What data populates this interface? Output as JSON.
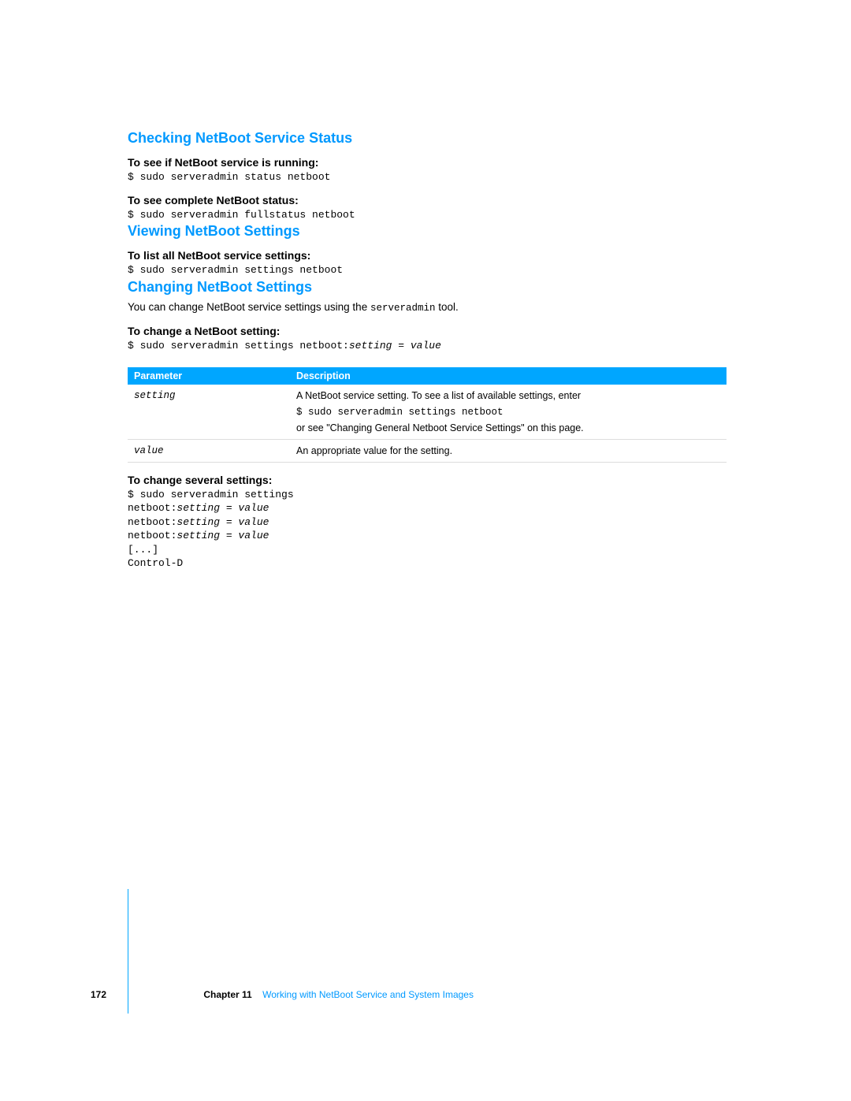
{
  "sections": {
    "s1": {
      "heading": "Checking NetBoot Service Status",
      "h1a": "To see if NetBoot service is running:",
      "c1a": "$ sudo serveradmin status netboot",
      "h1b": "To see complete NetBoot status:",
      "c1b": "$ sudo serveradmin fullstatus netboot"
    },
    "s2": {
      "heading": "Viewing NetBoot Settings",
      "h2a": "To list all NetBoot service settings:",
      "c2a": "$ sudo serveradmin settings netboot"
    },
    "s3": {
      "heading": "Changing NetBoot Settings",
      "para_pre": "You can change NetBoot service settings using the ",
      "para_mono": "serveradmin",
      "para_post": " tool.",
      "h3a": "To change a NetBoot setting:",
      "c3a_pre": "$ sudo serveradmin settings netboot:",
      "c3a_italic": "setting = value",
      "table": {
        "header_param": "Parameter",
        "header_desc": "Description",
        "rows": [
          {
            "param": "setting",
            "desc_line1": "A NetBoot service setting. To see a list of available settings, enter",
            "desc_mono": "$ sudo serveradmin settings netboot",
            "desc_line2": "or see \"Changing General Netboot Service Settings\" on this page."
          },
          {
            "param": "value",
            "desc_line1": "An appropriate value for the setting."
          }
        ]
      },
      "h3b": "To change several settings:",
      "c3b_line1": "$ sudo serveradmin settings",
      "c3b_nb": "netboot:",
      "c3b_sv": "setting = value",
      "c3b_ell": "[...]",
      "c3b_cd": "Control-D"
    }
  },
  "footer": {
    "page_number": "172",
    "chapter_label": "Chapter 11",
    "chapter_title": "Working with NetBoot Service and System Images"
  }
}
